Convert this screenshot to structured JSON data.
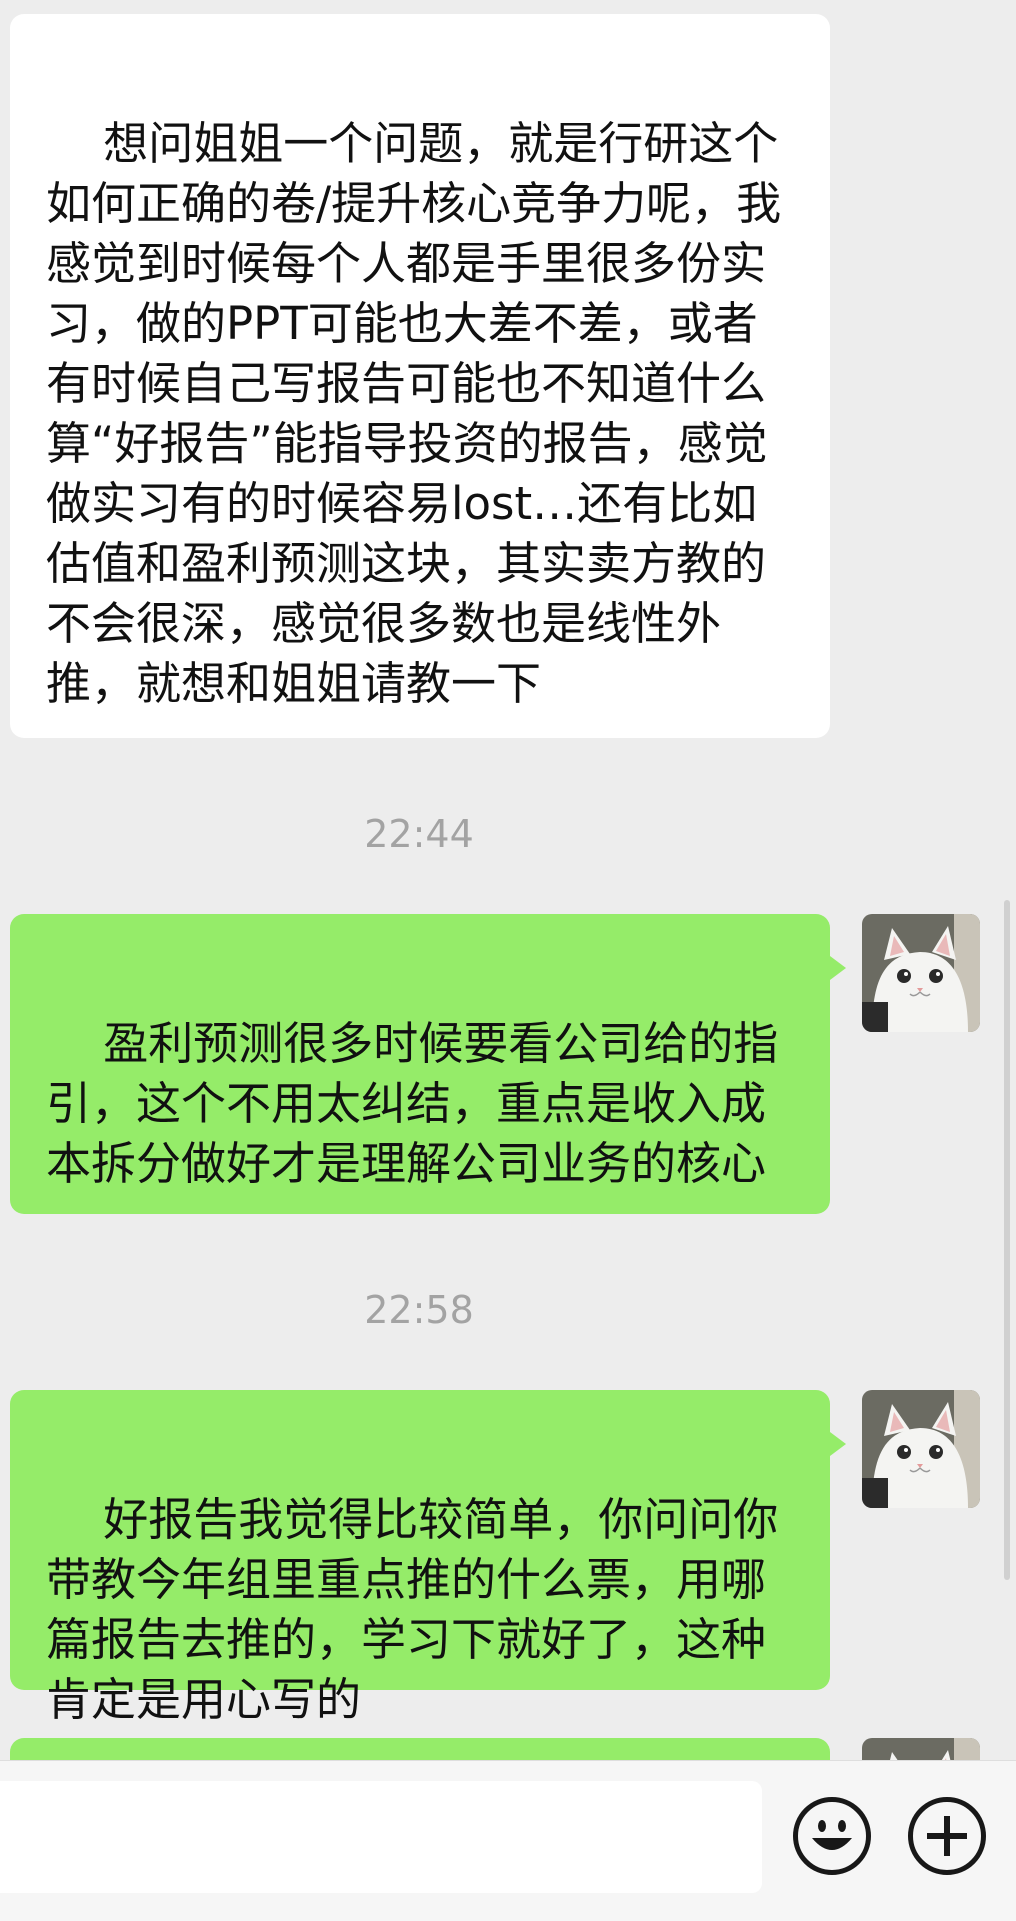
{
  "messages": [
    {
      "type": "incoming",
      "text": "想问姐姐一个问题，就是行研这个如何正确的卷/提升核心竞争力呢，我感觉到时候每个人都是手里很多份实习，做的PPT可能也大差不差，或者有时候自己写报告可能也不知道什么算“好报告”能指导投资的报告，感觉做实习有的时候容易lost…还有比如估值和盈利预测这块，其实卖方教的不会很深，感觉很多数也是线性外推，就想和姐姐请教一下"
    },
    {
      "type": "timestamp",
      "text": "22:44"
    },
    {
      "type": "outgoing",
      "text": "盈利预测很多时候要看公司给的指引，这个不用太纠结，重点是收入成本拆分做好才是理解公司业务的核心"
    },
    {
      "type": "timestamp",
      "text": "22:58"
    },
    {
      "type": "outgoing",
      "text": "好报告我觉得比较简单，你问问你带教今年组里重点推的什么票，用哪篇报告去推的，学习下就好了，这种肯定是用心写的"
    }
  ],
  "input": {
    "placeholder": ""
  },
  "icons": {
    "emoji": "smiley-face-icon",
    "more": "plus-circle-icon",
    "avatar": "white-cat-avatar"
  },
  "colors": {
    "background": "#ededed",
    "incoming_bubble": "#ffffff",
    "outgoing_bubble": "#95ec69",
    "timestamp_text": "#a3a3a3"
  }
}
